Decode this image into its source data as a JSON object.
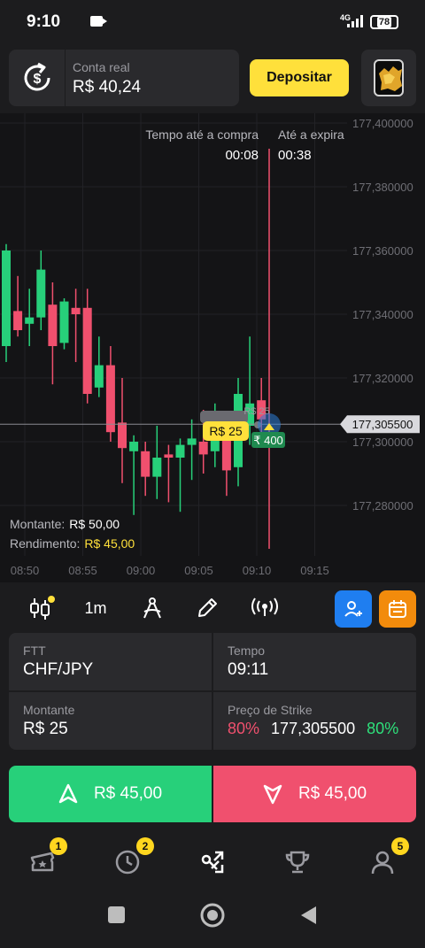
{
  "status_bar": {
    "time": "9:10",
    "network": "4G",
    "battery": "78"
  },
  "header": {
    "account_label": "Conta real",
    "balance": "R$ 40,24",
    "deposit_label": "Depositar"
  },
  "chart": {
    "countdown_purchase_label": "Tempo até a compra",
    "countdown_purchase_value": "00:08",
    "countdown_expiry_label": "Até a expira",
    "countdown_expiry_value": "00:38",
    "current_price_tag": "177,305500",
    "bet_marker": "R$ 25",
    "mini_bet_label": "R$ 25",
    "payout_badge": "₹ 400",
    "amount_label": "Montante:",
    "amount_value": "R$ 50,00",
    "yield_label": "Rendimento:",
    "yield_value": "R$ 45,00"
  },
  "chart_data": {
    "type": "candlestick",
    "y_ticks": [
      "177,400000",
      "177,380000",
      "177,360000",
      "177,340000",
      "177,320000",
      "177,300000",
      "177,280000"
    ],
    "x_ticks": [
      "08:50",
      "08:55",
      "09:00",
      "09:05",
      "09:10",
      "09:15"
    ],
    "ylim": [
      177.275,
      177.405
    ],
    "current_price": 177.3055,
    "candles": [
      {
        "o": 177.33,
        "h": 177.362,
        "l": 177.325,
        "c": 177.36
      },
      {
        "o": 177.341,
        "h": 177.352,
        "l": 177.333,
        "c": 177.335
      },
      {
        "o": 177.337,
        "h": 177.348,
        "l": 177.33,
        "c": 177.339
      },
      {
        "o": 177.339,
        "h": 177.36,
        "l": 177.335,
        "c": 177.354
      },
      {
        "o": 177.343,
        "h": 177.35,
        "l": 177.318,
        "c": 177.33
      },
      {
        "o": 177.331,
        "h": 177.345,
        "l": 177.329,
        "c": 177.344
      },
      {
        "o": 177.342,
        "h": 177.348,
        "l": 177.325,
        "c": 177.34
      },
      {
        "o": 177.342,
        "h": 177.348,
        "l": 177.312,
        "c": 177.315
      },
      {
        "o": 177.317,
        "h": 177.333,
        "l": 177.314,
        "c": 177.324
      },
      {
        "o": 177.324,
        "h": 177.33,
        "l": 177.3,
        "c": 177.303
      },
      {
        "o": 177.306,
        "h": 177.32,
        "l": 177.287,
        "c": 177.298
      },
      {
        "o": 177.297,
        "h": 177.302,
        "l": 177.277,
        "c": 177.3
      },
      {
        "o": 177.297,
        "h": 177.3,
        "l": 177.283,
        "c": 177.289
      },
      {
        "o": 177.289,
        "h": 177.305,
        "l": 177.282,
        "c": 177.295
      },
      {
        "o": 177.296,
        "h": 177.299,
        "l": 177.281,
        "c": 177.295
      },
      {
        "o": 177.295,
        "h": 177.301,
        "l": 177.278,
        "c": 177.299
      },
      {
        "o": 177.299,
        "h": 177.307,
        "l": 177.288,
        "c": 177.301
      },
      {
        "o": 177.3,
        "h": 177.31,
        "l": 177.29,
        "c": 177.296
      },
      {
        "o": 177.297,
        "h": 177.312,
        "l": 177.292,
        "c": 177.307
      },
      {
        "o": 177.301,
        "h": 177.306,
        "l": 177.283,
        "c": 177.291
      },
      {
        "o": 177.292,
        "h": 177.32,
        "l": 177.286,
        "c": 177.315
      },
      {
        "o": 177.305,
        "h": 177.333,
        "l": 177.299,
        "c": 177.312
      },
      {
        "o": 177.313,
        "h": 177.32,
        "l": 177.3,
        "c": 177.307
      }
    ]
  },
  "toolbar": {
    "timeframe": "1m"
  },
  "params": {
    "asset_label": "FTT",
    "asset_value": "CHF/JPY",
    "time_label": "Tempo",
    "time_value": "09:11",
    "amount_label": "Montante",
    "amount_value": "R$ 25",
    "strike_label": "Preço de Strike",
    "strike_pct_down": "80%",
    "strike_value": "177,305500",
    "strike_pct_up": "80%"
  },
  "trade": {
    "up_label": "R$ 45,00",
    "down_label": "R$ 45,00",
    "up_color": "#27d07a",
    "down_color": "#f0506e"
  },
  "bottom_nav": {
    "badge_tickets": "1",
    "badge_history": "2",
    "badge_profile": "5"
  },
  "colors": {
    "accent": "#ffe03b",
    "bull": "#27d07a",
    "bear": "#f0506e"
  }
}
